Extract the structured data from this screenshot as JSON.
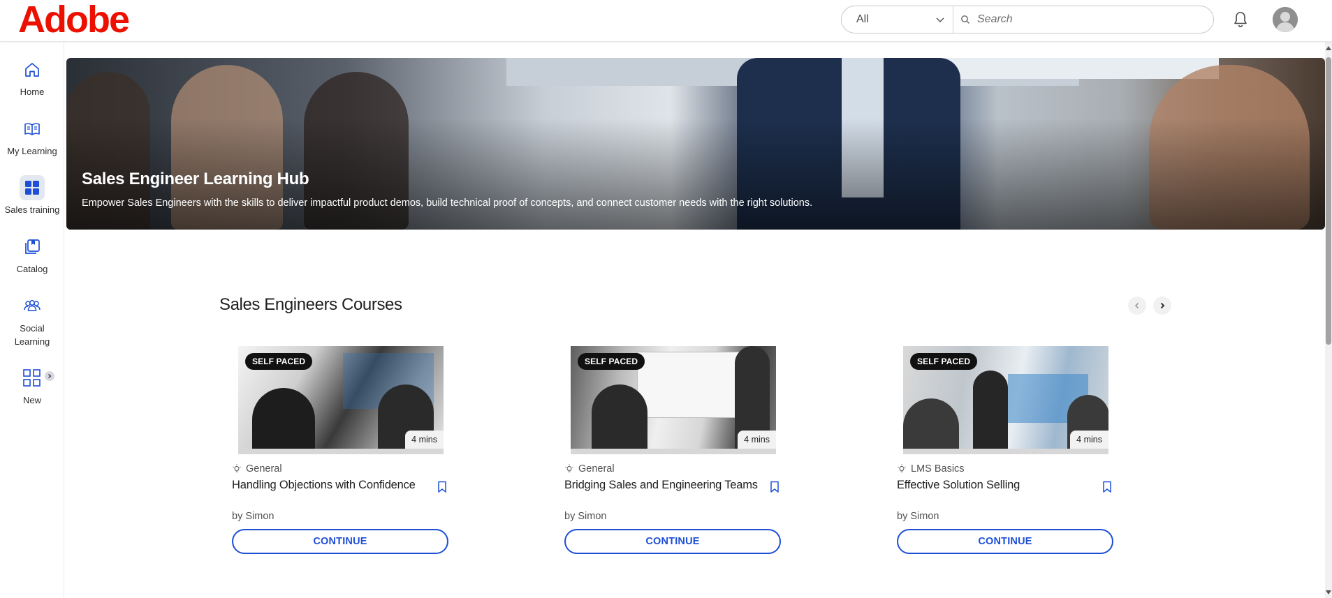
{
  "header": {
    "logo_text": "Adobe",
    "search_scope": "All",
    "search_placeholder": "Search"
  },
  "sidebar": {
    "items": [
      {
        "label": "Home",
        "icon": "home-icon"
      },
      {
        "label": "My Learning",
        "icon": "book-icon"
      },
      {
        "label": "Sales training",
        "icon": "grid-tiles-icon",
        "active": true
      },
      {
        "label": "Catalog",
        "icon": "catalog-icon"
      },
      {
        "label": "Social Learning",
        "icon": "people-icon"
      },
      {
        "label": "New",
        "icon": "grid-outline-icon"
      }
    ]
  },
  "hero": {
    "title": "Sales Engineer Learning Hub",
    "subtitle": "Empower Sales Engineers with the skills to deliver impactful product demos, build technical proof of concepts, and connect customer needs with the right solutions."
  },
  "section": {
    "title": "Sales Engineers Courses"
  },
  "courses": [
    {
      "badge": "SELF PACED",
      "duration": "4 mins",
      "category": "General",
      "title": "Handling Objections with Confidence",
      "author": "by Simon",
      "action": "CONTINUE"
    },
    {
      "badge": "SELF PACED",
      "duration": "4 mins",
      "category": "General",
      "title": "Bridging Sales and Engineering Teams",
      "author": "by Simon",
      "action": "CONTINUE"
    },
    {
      "badge": "SELF PACED",
      "duration": "4 mins",
      "category": "LMS Basics",
      "title": "Effective Solution Selling",
      "author": "by Simon",
      "action": "CONTINUE"
    }
  ],
  "colors": {
    "brand": "#eb1000",
    "accent": "#1d4fd6",
    "active_nav_bg": "#e3e7f0"
  }
}
